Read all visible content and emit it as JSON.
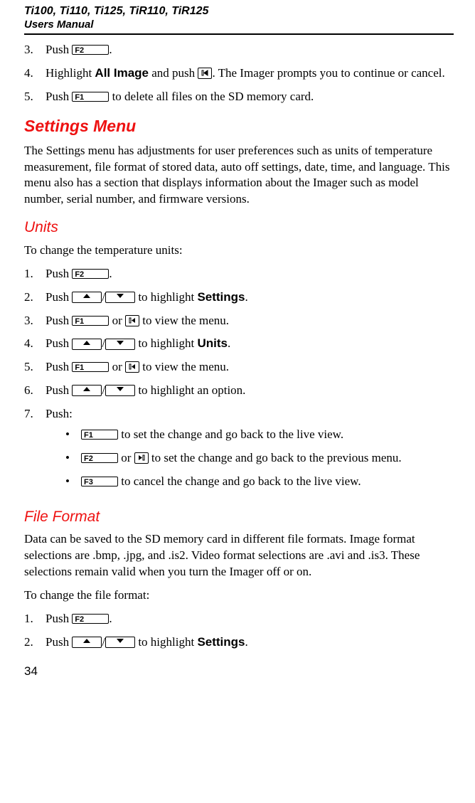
{
  "header": {
    "models": "Ti100, Ti110, Ti125, TiR110, TiR125",
    "subtitle": "Users Manual"
  },
  "keys": {
    "f1": "F1",
    "f2": "F2",
    "f3": "F3"
  },
  "sec1": {
    "step3a": "Push ",
    "step3b": ".",
    "step4a": "Highlight ",
    "step4bold": "All Image",
    "step4b": " and push ",
    "step4c": ". The Imager prompts you to continue or cancel.",
    "step5a": "Push ",
    "step5b": " to delete all files on the SD memory card."
  },
  "settingsMenu": {
    "title": "Settings Menu",
    "para": "The Settings menu has adjustments for user preferences such as units of temperature measurement, file format of stored data, auto off settings, date, time, and language. This menu also has a section that displays information about the Imager such as model number, serial number, and firmware versions."
  },
  "units": {
    "title": "Units",
    "intro": "To change the temperature units:",
    "s1a": "Push ",
    "s1b": ".",
    "s2a": "Push ",
    "s2b": "/",
    "s2c": " to highlight ",
    "s2bold": "Settings",
    "s2d": ".",
    "s3a": "Push ",
    "s3b": " or ",
    "s3c": " to view the menu.",
    "s4a": "Push ",
    "s4b": "/",
    "s4c": " to highlight ",
    "s4bold": "Units",
    "s4d": ".",
    "s5a": "Push ",
    "s5b": " or ",
    "s5c": " to view the menu.",
    "s6a": "Push ",
    "s6b": "/",
    "s6c": " to highlight an option.",
    "s7": "Push:",
    "b1a": " to set the change and go back to the live view.",
    "b2a": " or ",
    "b2b": " to set the change and go back to the previous menu.",
    "b3a": " to cancel the change and go back to the live view."
  },
  "fileFormat": {
    "title": "File Format",
    "para": "Data can be saved to the SD memory card in different file formats. Image format selections are .bmp, .jpg, and .is2. Video format selections are .avi and .is3. These selections remain valid when you turn the Imager off or on.",
    "intro": "To change the file format:",
    "s1a": "Push ",
    "s1b": ".",
    "s2a": "Push ",
    "s2b": "/",
    "s2c": " to highlight ",
    "s2bold": "Settings",
    "s2d": "."
  },
  "page": "34"
}
